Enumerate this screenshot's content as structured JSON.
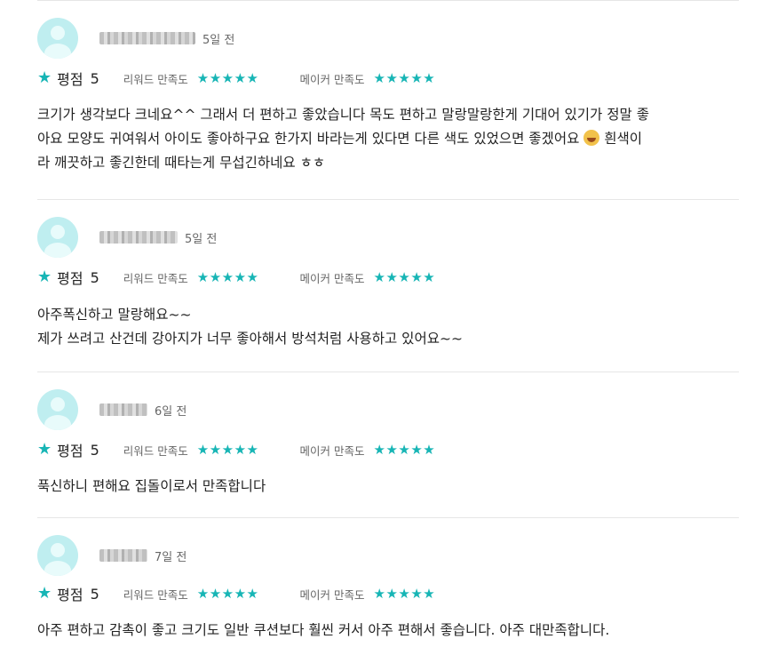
{
  "labels": {
    "rating": "평점",
    "review_satisfaction": "리워드 만족도",
    "maker_satisfaction": "메이커 만족도"
  },
  "colors": {
    "accent": "#17b5b5",
    "avatar": "#bfeef0"
  },
  "reviews": [
    {
      "time": "5일 전",
      "rating": "5",
      "review_stars": "★★★★★",
      "maker_stars": "★★★★★",
      "comment_lines": [
        "크기가 생각보다 크네요^^ 그래서 더 편하고 좋았습니다 목도 편하고 말랑말랑한게 기대어 있기가 정말 좋",
        "아요 모양도 귀여워서 아이도 좋아하구요 한가지 바라는게 있다면 다른 색도 있었으면 좋겠어요",
        "흰색이",
        "라 깨끗하고 좋긴한데 때타는게 무섭긴하네요 ㅎㅎ"
      ]
    },
    {
      "time": "5일 전",
      "rating": "5",
      "review_stars": "★★★★★",
      "maker_stars": "★★★★★",
      "comment_lines": [
        "아주폭신하고 말랑해요~~",
        "제가 쓰려고 산건데 강아지가 너무 좋아해서 방석처럼 사용하고 있어요~~"
      ]
    },
    {
      "time": "6일 전",
      "rating": "5",
      "review_stars": "★★★★★",
      "maker_stars": "★★★★★",
      "comment_lines": [
        "푹신하니 편해요 집돌이로서 만족합니다"
      ]
    },
    {
      "time": "7일 전",
      "rating": "5",
      "review_stars": "★★★★★",
      "maker_stars": "★★★★★",
      "comment_lines": [
        "아주 편하고 감촉이 좋고 크기도 일반 쿠션보다 훨씬 커서 아주 편해서 좋습니다. 아주 대만족합니다."
      ]
    }
  ]
}
